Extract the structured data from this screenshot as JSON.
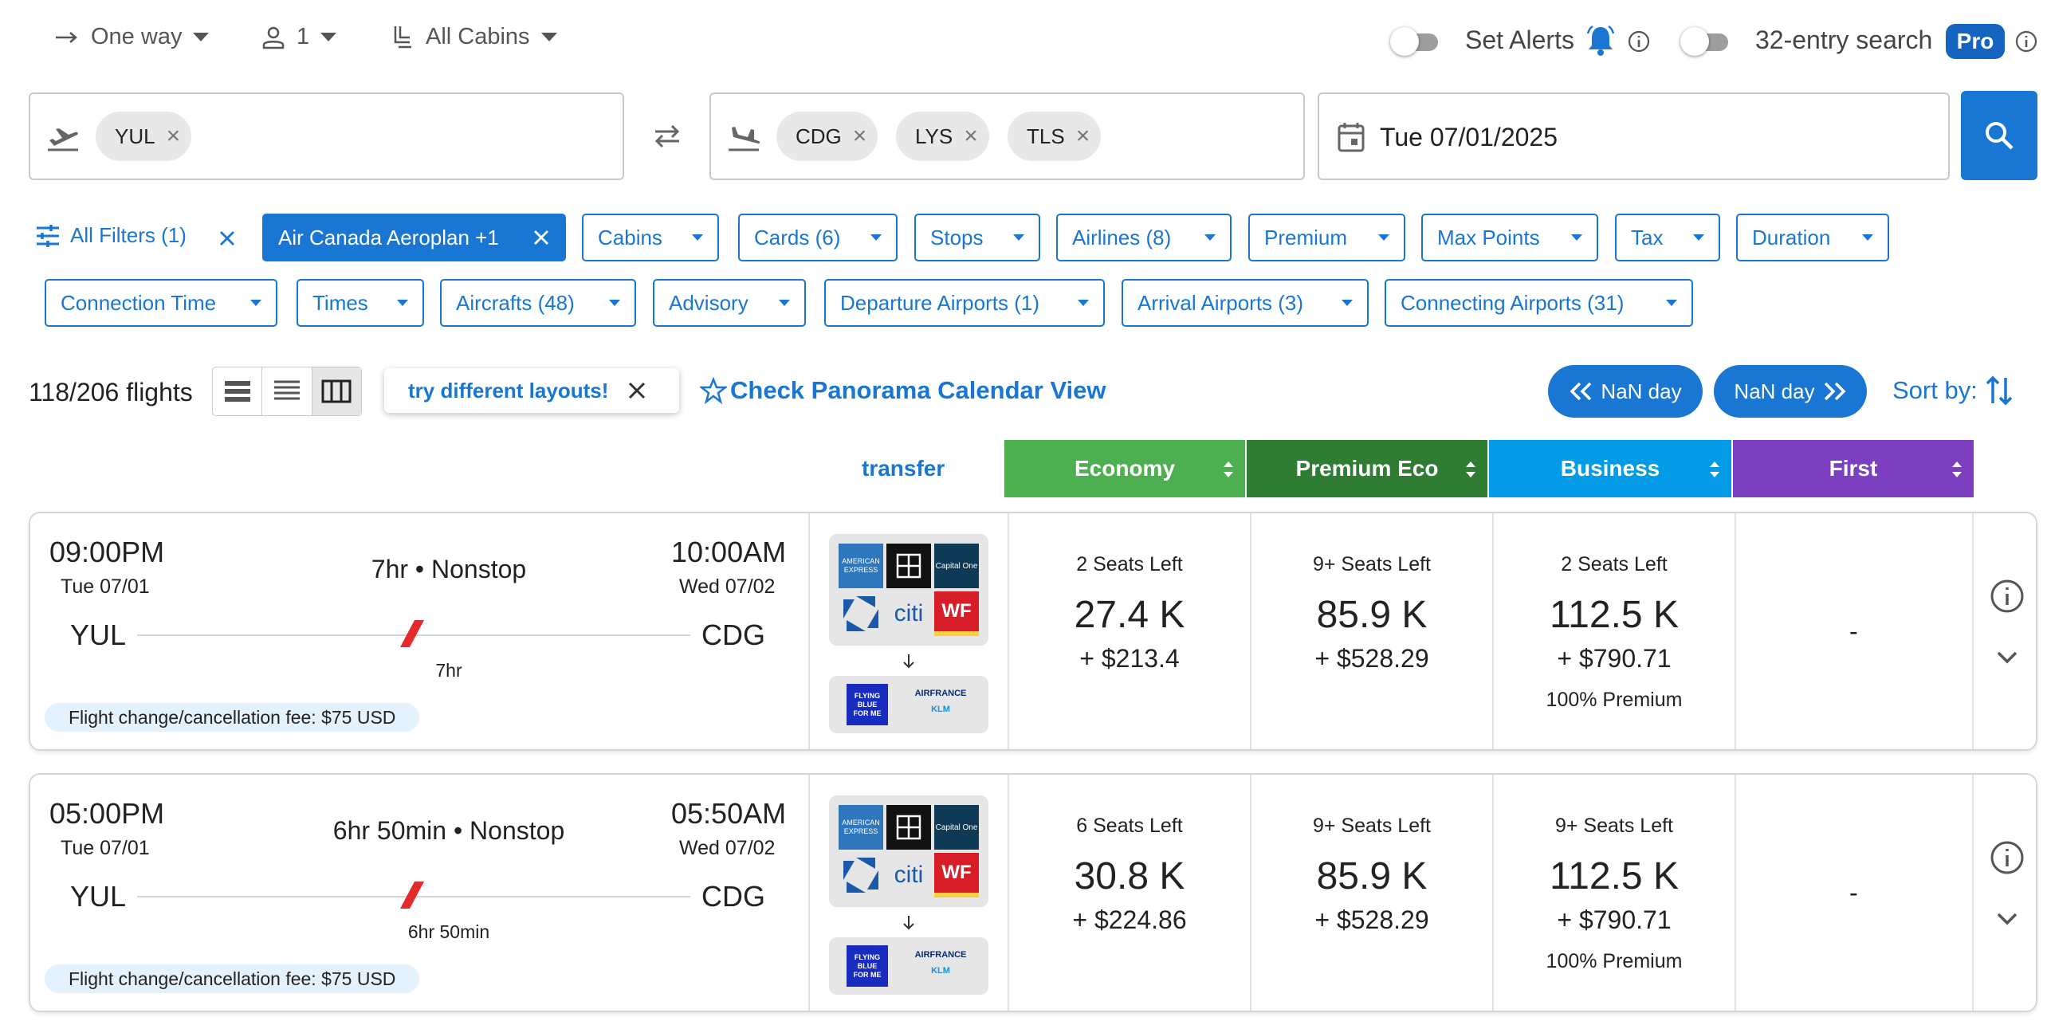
{
  "top": {
    "trip_type": "One way",
    "passengers": "1",
    "cabin": "All Cabins",
    "set_alerts": "Set Alerts",
    "entry_search": "32-entry search",
    "pro_badge": "Pro"
  },
  "search": {
    "origin_chips": [
      "YUL"
    ],
    "destination_chips": [
      "CDG",
      "LYS",
      "TLS"
    ],
    "date": "Tue 07/01/2025"
  },
  "filters": {
    "all_filters": "All Filters (1)",
    "program": "Air Canada Aeroplan +1",
    "row1": [
      "Cabins",
      "Cards (6)",
      "Stops",
      "Airlines (8)",
      "Premium",
      "Max Points",
      "Tax",
      "Duration"
    ],
    "row2": [
      "Connection Time",
      "Times",
      "Aircrafts (48)",
      "Advisory",
      "Departure Airports (1)",
      "Arrival Airports (3)",
      "Connecting Airports (31)"
    ]
  },
  "results": {
    "count": "118/206 flights",
    "layout_tip": "try different layouts!",
    "panorama": "Check Panorama Calendar View",
    "prev_day": "NaN day",
    "next_day": "NaN day",
    "sort_by": "Sort by:"
  },
  "columns": {
    "transfer": "transfer",
    "economy": "Economy",
    "premium": "Premium Eco",
    "business": "Business",
    "first": "First"
  },
  "colors": {
    "economy": "#4caf50",
    "premium": "#2e7d32",
    "business": "#039be5",
    "first": "#7b3fbf",
    "accent": "#1976d2"
  },
  "flights": [
    {
      "dep_time": "09:00PM",
      "dep_date": "Tue 07/01",
      "arr_time": "10:00AM",
      "arr_date": "Wed 07/02",
      "duration_line": "7hr • Nonstop",
      "duration": "7hr",
      "from": "YUL",
      "to": "CDG",
      "fee": "Flight change/cancellation fee: $75 USD",
      "economy": {
        "seats": "2 Seats Left",
        "points": "27.4 K",
        "tax": "+ $213.4"
      },
      "premium": {
        "seats": "9+ Seats Left",
        "points": "85.9 K",
        "tax": "+ $528.29"
      },
      "business": {
        "seats": "2 Seats Left",
        "points": "112.5 K",
        "tax": "+ $790.71",
        "note": "100% Premium"
      },
      "first": "-"
    },
    {
      "dep_time": "05:00PM",
      "dep_date": "Tue 07/01",
      "arr_time": "05:50AM",
      "arr_date": "Wed 07/02",
      "duration_line": "6hr 50min • Nonstop",
      "duration": "6hr 50min",
      "from": "YUL",
      "to": "CDG",
      "fee": "Flight change/cancellation fee: $75 USD",
      "economy": {
        "seats": "6 Seats Left",
        "points": "30.8 K",
        "tax": "+ $224.86"
      },
      "premium": {
        "seats": "9+ Seats Left",
        "points": "85.9 K",
        "tax": "+ $528.29"
      },
      "business": {
        "seats": "9+ Seats Left",
        "points": "112.5 K",
        "tax": "+ $790.71",
        "note": "100% Premium"
      },
      "first": "-"
    }
  ],
  "partner_logos": {
    "amex": "AMERICAN EXPRESS",
    "citi": "citi",
    "wf": "WF",
    "capital_one": "Capital One",
    "flying_blue": [
      "FLYING",
      "BLUE",
      "FOR ME"
    ],
    "airfrance": "AIRFRANCE",
    "klm": "KLM"
  }
}
